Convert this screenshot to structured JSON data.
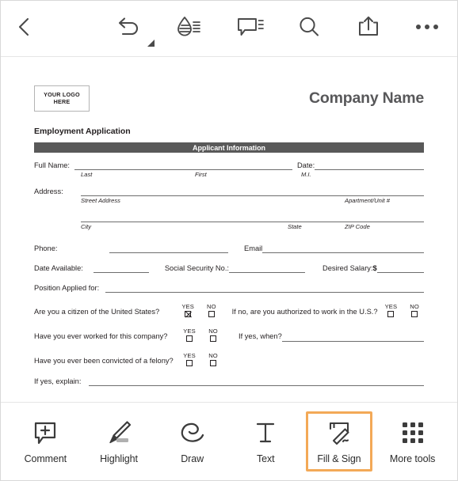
{
  "app": {
    "accent_color": "#f3a957",
    "document_ink": "#231f20",
    "section_bar_color": "#595959"
  },
  "top_toolbar": {
    "items": [
      {
        "name": "back-button",
        "icon": "chevron-left-icon",
        "label": "Back"
      },
      {
        "name": "undo-button",
        "icon": "undo-icon",
        "label": "Undo",
        "has_dropdown": true
      },
      {
        "name": "ink-tool-button",
        "icon": "droplet-lines-icon",
        "label": "Highlight color"
      },
      {
        "name": "comment-button",
        "icon": "comment-lines-icon",
        "label": "Comments"
      },
      {
        "name": "search-button",
        "icon": "search-icon",
        "label": "Search"
      },
      {
        "name": "share-button",
        "icon": "share-upload-icon",
        "label": "Share"
      },
      {
        "name": "more-button",
        "icon": "ellipsis-icon",
        "label": "More"
      }
    ]
  },
  "document": {
    "logo_line1": "YOUR LOGO",
    "logo_line2": "HERE",
    "company_name": "Company Name",
    "title": "Employment Application",
    "section_header": "Applicant Information",
    "fields": {
      "full_name_label": "Full Name:",
      "full_name_hint_last": "Last",
      "full_name_hint_first": "First",
      "full_name_hint_mi": "M.I.",
      "date_label": "Date:",
      "address_label": "Address:",
      "street_hint": "Street Address",
      "apartment_hint": "Apartment/Unit #",
      "city_hint": "City",
      "state_hint": "State",
      "zip_hint": "ZIP Code",
      "phone_label": "Phone:",
      "email_label": "Email",
      "date_available_label": "Date Available:",
      "ssn_label": "Social Security No.:",
      "desired_salary_label": "Desired Salary:",
      "desired_salary_currency": "$",
      "position_label": "Position Applied for:",
      "if_yes_explain_label": "If yes, explain:"
    },
    "yes_no_caption_yes": "YES",
    "yes_no_caption_no": "NO",
    "questions": [
      {
        "text": "Are you a citizen of the United States?",
        "yes_checked": true,
        "no_checked": false,
        "follow_up_text": "If no, are you authorized to work in the U.S.?",
        "follow_up_type": "yesno",
        "follow_up_yes_checked": false,
        "follow_up_no_checked": false
      },
      {
        "text": "Have you ever worked for this company?",
        "yes_checked": false,
        "no_checked": false,
        "follow_up_text": "If yes, when?",
        "follow_up_type": "line"
      },
      {
        "text": "Have you ever been convicted of a felony?",
        "yes_checked": false,
        "no_checked": false,
        "follow_up_type": "none"
      }
    ]
  },
  "bottom_toolbar": {
    "tools": [
      {
        "name": "comment",
        "label": "Comment",
        "icon": "comment-plus-icon",
        "selected": false
      },
      {
        "name": "highlight",
        "label": "Highlight",
        "icon": "highlighter-icon",
        "selected": false
      },
      {
        "name": "draw",
        "label": "Draw",
        "icon": "draw-loop-icon",
        "selected": false
      },
      {
        "name": "text",
        "label": "Text",
        "icon": "text-t-icon",
        "selected": false
      },
      {
        "name": "fill-sign",
        "label": "Fill & Sign",
        "icon": "fill-sign-icon",
        "selected": true
      },
      {
        "name": "more-tools",
        "label": "More tools",
        "icon": "grid-dots-icon",
        "selected": false
      }
    ]
  }
}
